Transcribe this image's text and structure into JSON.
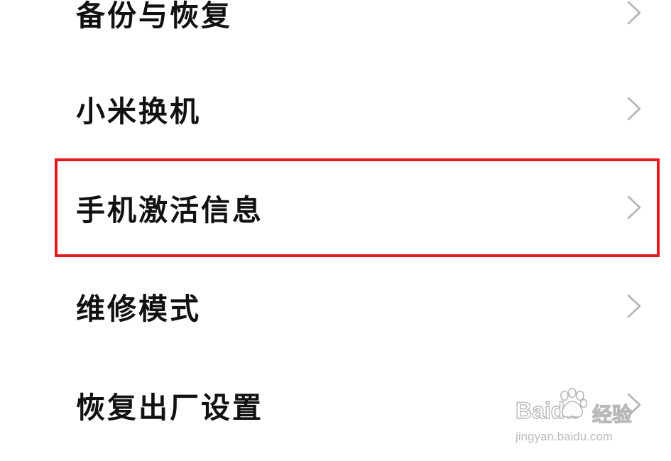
{
  "settings": {
    "items": [
      {
        "label": "备份与恢复"
      },
      {
        "label": "小米换机"
      },
      {
        "label": "手机激活信息",
        "highlighted": true
      },
      {
        "label": "维修模式"
      },
      {
        "label": "恢复出厂设置"
      }
    ]
  },
  "annotation": {
    "highlight_color": "#e3191d"
  },
  "watermark": {
    "brand": "Baidu",
    "product": "经验",
    "url": "jingyan.baidu.com"
  },
  "icons": {
    "chevron": "chevron-right-icon",
    "watermark_logo": "baidu-paw-icon"
  }
}
